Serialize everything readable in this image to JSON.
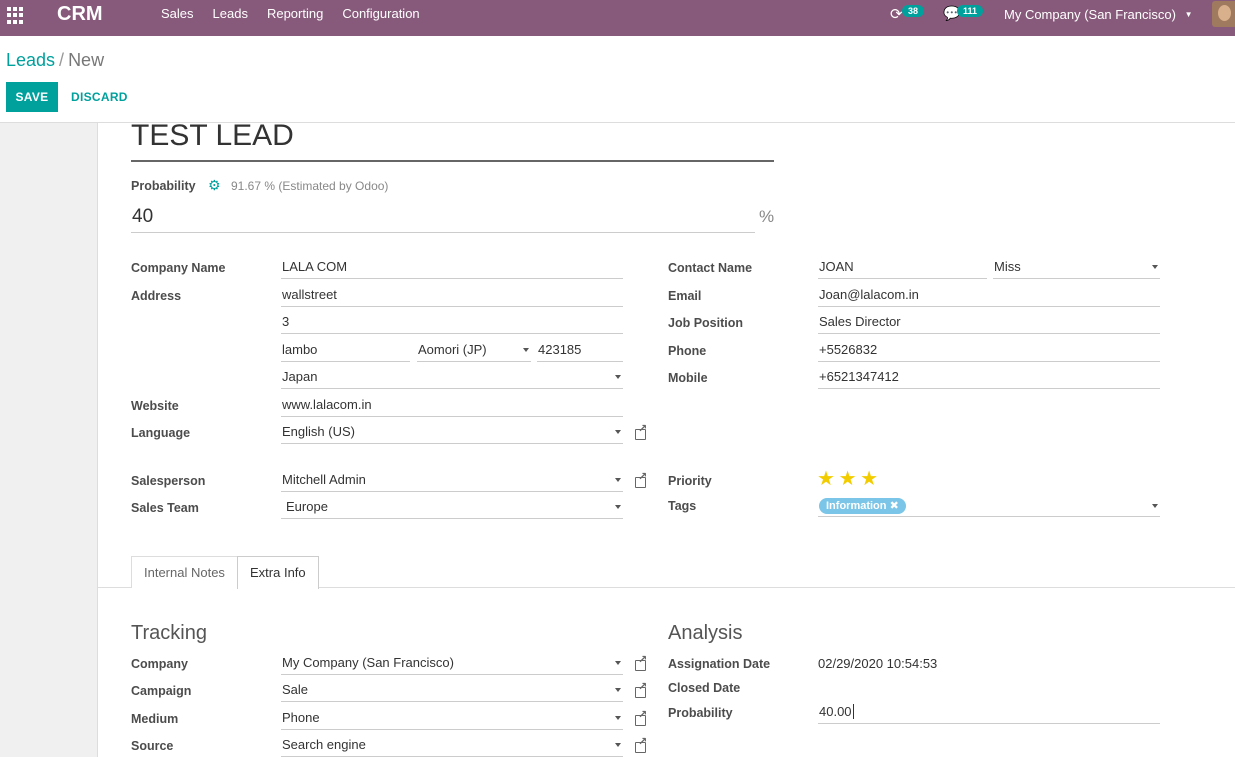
{
  "nav": {
    "app_name": "CRM",
    "menu": [
      "Sales",
      "Leads",
      "Reporting",
      "Configuration"
    ],
    "activity_count": "38",
    "message_count": "111",
    "company": "My Company (San Francisco)"
  },
  "breadcrumb": {
    "parent": "Leads",
    "separator": "/",
    "current": "New"
  },
  "actions": {
    "save": "SAVE",
    "discard": "DISCARD"
  },
  "lead": {
    "title": "TEST LEAD",
    "probability_label": "Probability",
    "probability_estimate": "91.67 % (Estimated by Odoo)",
    "probability_value": "40",
    "percent_sign": "%"
  },
  "left_fields": {
    "company_name_label": "Company Name",
    "company_name": "LALA COM",
    "address_label": "Address",
    "street": "wallstreet",
    "street2": "3",
    "city": "lambo",
    "state": "Aomori (JP)",
    "zip": "423185",
    "country": "Japan",
    "website_label": "Website",
    "website": "www.lalacom.in",
    "language_label": "Language",
    "language": "English (US)",
    "salesperson_label": "Salesperson",
    "salesperson": "Mitchell Admin",
    "sales_team_label": "Sales Team",
    "sales_team": "Europe"
  },
  "right_fields": {
    "contact_name_label": "Contact Name",
    "contact_name": "JOAN",
    "title": "Miss",
    "email_label": "Email",
    "email": "Joan@lalacom.in",
    "job_position_label": "Job Position",
    "job_position": "Sales Director",
    "phone_label": "Phone",
    "phone": "+5526832",
    "mobile_label": "Mobile",
    "mobile": "+6521347412",
    "priority_label": "Priority",
    "priority_stars": 3,
    "tags_label": "Tags",
    "tag": "Information"
  },
  "tabs": [
    "Internal Notes",
    "Extra Info"
  ],
  "tracking": {
    "heading": "Tracking",
    "company_label": "Company",
    "company": "My Company (San Francisco)",
    "campaign_label": "Campaign",
    "campaign": "Sale",
    "medium_label": "Medium",
    "medium": "Phone",
    "source_label": "Source",
    "source": "Search engine"
  },
  "analysis": {
    "heading": "Analysis",
    "assignation_label": "Assignation Date",
    "assignation": "02/29/2020 10:54:53",
    "closed_label": "Closed Date",
    "probability_label": "Probability",
    "probability": "40.00"
  },
  "colors": {
    "brand": "#875a7b",
    "accent": "#00a09d",
    "tag": "#7ac5e8",
    "star": "#f3cc00"
  }
}
